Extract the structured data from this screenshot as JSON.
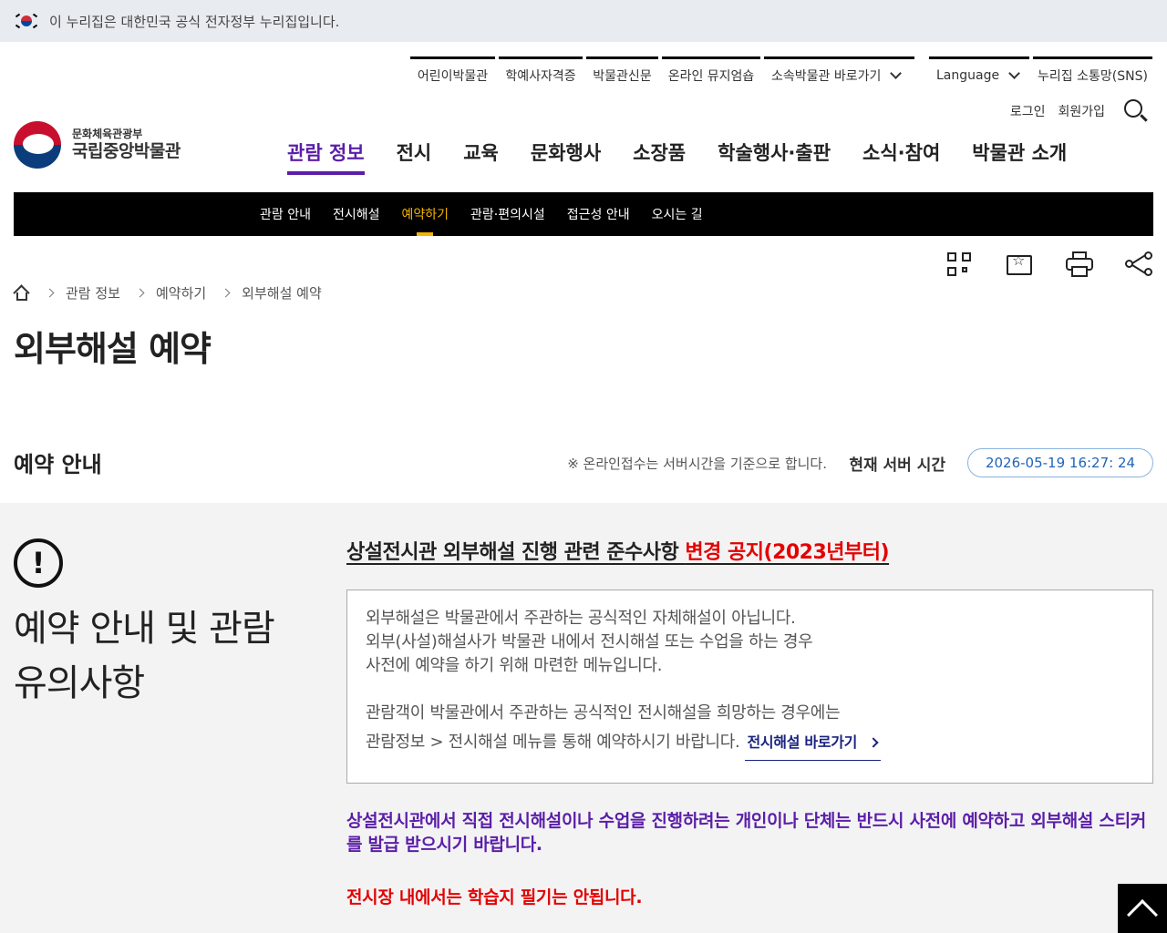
{
  "gov_banner": {
    "text": "이 누리집은 대한민국 공식 전자정부 누리집입니다."
  },
  "util_nav": {
    "items": [
      "어린이박물관",
      "학예사자격증",
      "박물관신문",
      "온라인 뮤지엄숍",
      "소속박물관 바로가기",
      "Language",
      "누리집 소통망(SNS)"
    ]
  },
  "auth": {
    "login": "로그인",
    "signup": "회원가입"
  },
  "logo": {
    "ministry": "문화체육관광부",
    "name": "국립중앙박물관"
  },
  "gnb": {
    "items": [
      "관람 정보",
      "전시",
      "교육",
      "문화행사",
      "소장품",
      "학술행사·출판",
      "소식·참여",
      "박물관 소개"
    ],
    "active_index": 0
  },
  "subnav": {
    "items": [
      "관람 안내",
      "전시해설",
      "예약하기",
      "관람·편의시설",
      "접근성 안내",
      "오시는 길"
    ],
    "active_index": 2
  },
  "tools": [
    "qr-code-icon",
    "bookmark-icon",
    "print-icon",
    "share-icon"
  ],
  "breadcrumb": {
    "items": [
      "관람 정보",
      "예약하기",
      "외부해설 예약"
    ]
  },
  "page_title": "외부해설 예약",
  "reservation": {
    "section_title": "예약 안내",
    "server_note": "※ 온라인접수는 서버시간을 기준으로 합니다.",
    "server_label": "현재 서버 시간",
    "server_time": "2026-05-19 16:27: 24"
  },
  "notice": {
    "side_title_line1": "예약 안내 및 관람",
    "side_title_line2": "유의사항",
    "title_main": "상설전시관 외부해설 진행 관련 준수사항 ",
    "title_red": "변경 공지(2023년부터)",
    "box_line1": "외부해설은 박물관에서 주관하는 공식적인 자체해설이 아닙니다.",
    "box_line2": "외부(사설)해설사가 박물관 내에서 전시해설 또는 수업을 하는 경우",
    "box_line3": "사전에 예약을 하기 위해 마련한 메뉴입니다.",
    "box_line4": "관람객이 박물관에서 주관하는 공식적인 전시해설을 희망하는 경우에는",
    "box_line5": "관람정보 > 전시해설 메뉴를 통해 예약하시기 바랍니다.",
    "link_label": "전시해설 바로가기",
    "purple_text": "상설전시관에서 직접 전시해설이나 수업을 진행하려는 개인이나 단체는 반드시 사전에 예약하고 외부해설 스티커를 발급 받으시기 바랍니다.",
    "red_text": "전시장 내에서는 학습지 필기는 안됩니다."
  },
  "colors": {
    "accent_purple": "#5b1ea8",
    "accent_yellow": "#f4b400",
    "red": "#e30000",
    "time_blue": "#1f64b8"
  }
}
